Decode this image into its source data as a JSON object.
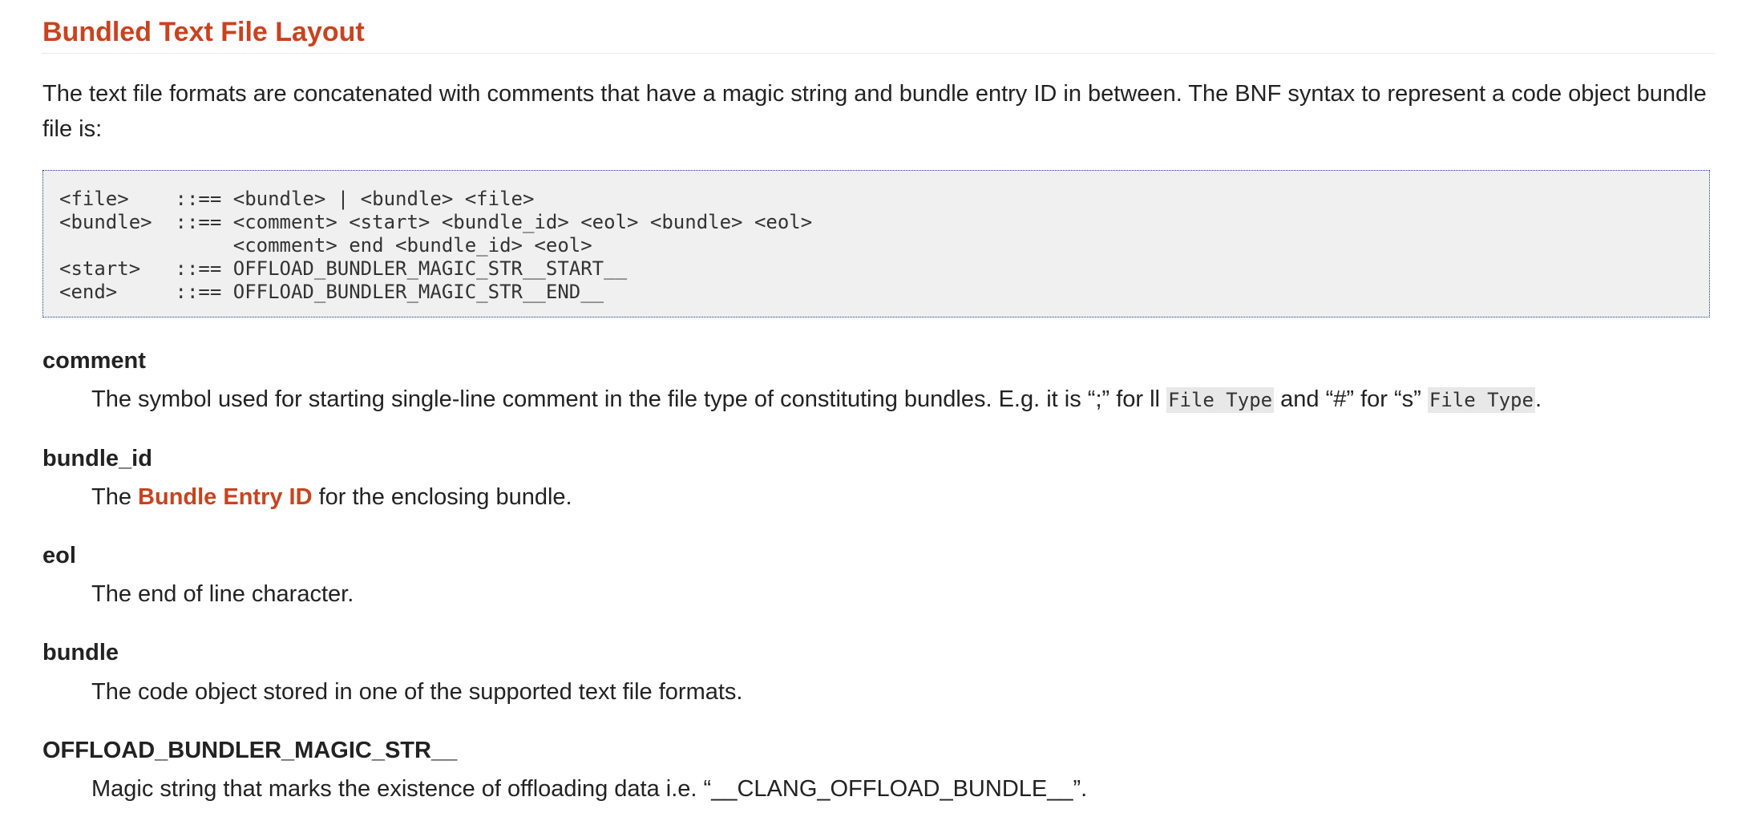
{
  "section": {
    "title": "Bundled Text File Layout"
  },
  "intro": {
    "text": "The text file formats are concatenated with comments that have a magic string and bundle entry ID in between. The BNF syntax to represent a code object bundle file is:"
  },
  "bnf": {
    "lines": [
      "<file>    ::== <bundle> | <bundle> <file>",
      "<bundle>  ::== <comment> <start> <bundle_id> <eol> <bundle> <eol>",
      "               <comment> end <bundle_id> <eol>",
      "<start>   ::== OFFLOAD_BUNDLER_MAGIC_STR__START__",
      "<end>     ::== OFFLOAD_BUNDLER_MAGIC_STR__END__"
    ]
  },
  "definitions": {
    "comment": {
      "term": "comment",
      "text_1": "The symbol used for starting single-line comment in the file type of constituting bundles. E.g. it is “;” for ll ",
      "code_1": "File Type",
      "text_2": " and “#” for “s” ",
      "code_2": "File Type",
      "text_3": "."
    },
    "bundle_id": {
      "term": "bundle_id",
      "text_1": "The ",
      "link": "Bundle Entry ID",
      "text_2": " for the enclosing bundle."
    },
    "eol": {
      "term": "eol",
      "text": "The end of line character."
    },
    "bundle": {
      "term": "bundle",
      "text": "The code object stored in one of the supported text file formats."
    },
    "magic": {
      "term": "OFFLOAD_BUNDLER_MAGIC_STR__",
      "text": "Magic string that marks the existence of offloading data i.e. “__CLANG_OFFLOAD_BUNDLE__”."
    }
  },
  "colors": {
    "heading": "#c9431f",
    "link": "#c9431f",
    "text": "#222222",
    "code_background": "#f0f0f0",
    "code_border": "#1f3a8a"
  }
}
